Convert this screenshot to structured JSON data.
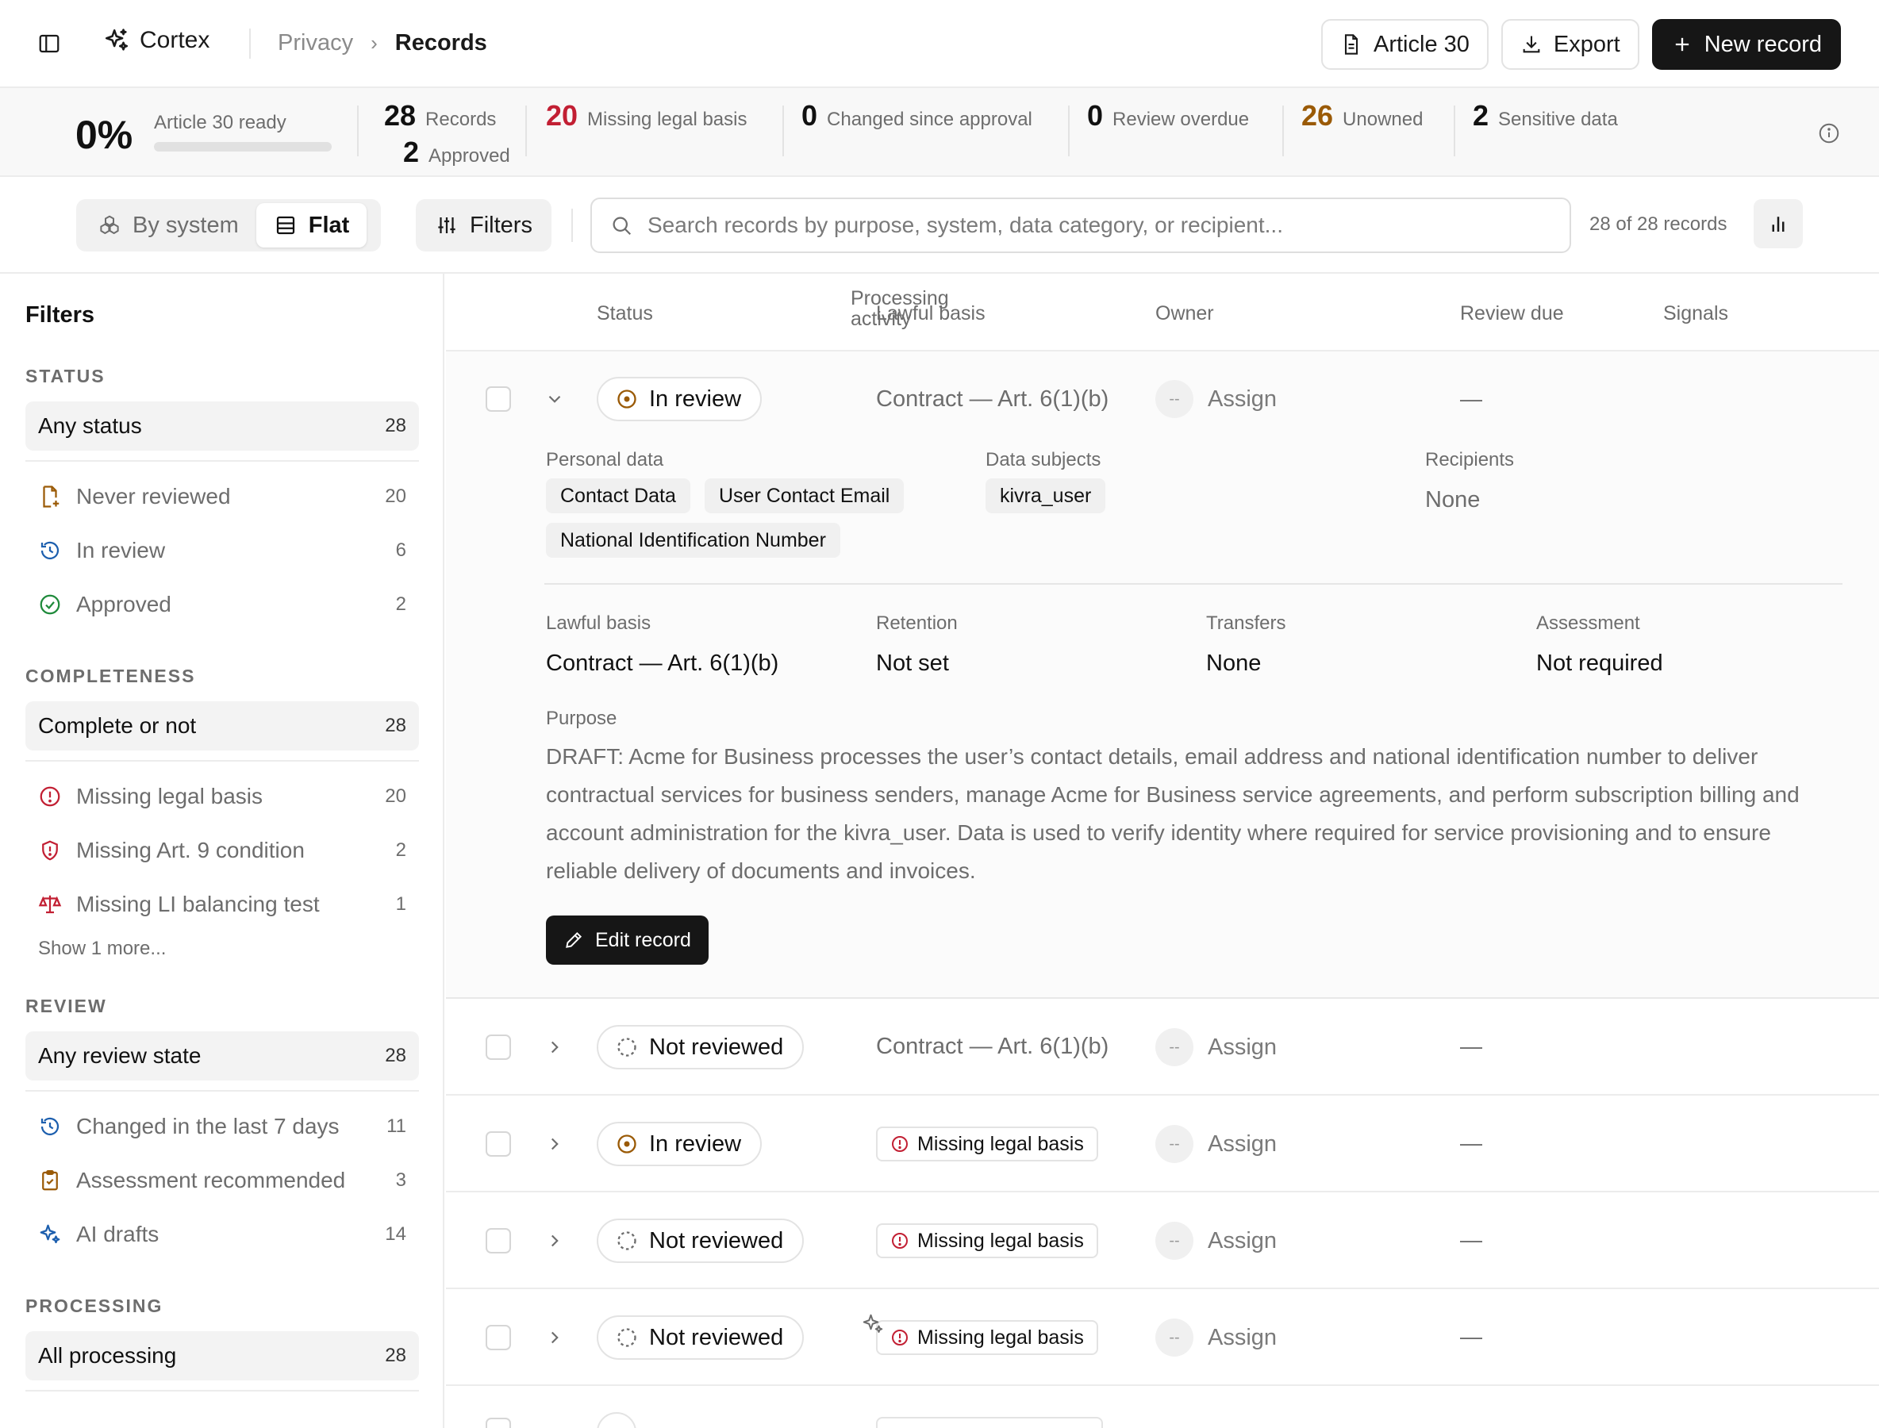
{
  "header": {
    "brand": "Cortex",
    "breadcrumb": [
      "Privacy",
      "Records"
    ],
    "actions": {
      "article30": "Article 30",
      "export": "Export",
      "new_record": "New record"
    }
  },
  "metrics": {
    "ready_pct": "0%",
    "ready_label": "Article 30 ready",
    "ready_progress": 0,
    "records": {
      "num": "28",
      "label": "Records"
    },
    "approved": {
      "num": "2",
      "label": "Approved"
    },
    "missing": {
      "num": "20",
      "label": "Missing legal basis"
    },
    "changed": {
      "num": "0",
      "label": "Changed since approval"
    },
    "overdue": {
      "num": "0",
      "label": "Review overdue"
    },
    "unowned": {
      "num": "26",
      "label": "Unowned"
    },
    "sensitive": {
      "num": "2",
      "label": "Sensitive data"
    }
  },
  "toolbar": {
    "by_system": "By system",
    "flat": "Flat",
    "filters": "Filters",
    "search_placeholder": "Search records by purpose, system, data category, or recipient...",
    "count": "28 of 28 records"
  },
  "sidebar": {
    "title": "Filters",
    "status": {
      "heading": "STATUS",
      "all": {
        "label": "Any status",
        "count": "28"
      },
      "items": [
        {
          "label": "Never reviewed",
          "count": "20"
        },
        {
          "label": "In review",
          "count": "6"
        },
        {
          "label": "Approved",
          "count": "2"
        }
      ]
    },
    "completeness": {
      "heading": "COMPLETENESS",
      "all": {
        "label": "Complete or not",
        "count": "28"
      },
      "items": [
        {
          "label": "Missing legal basis",
          "count": "20"
        },
        {
          "label": "Missing Art. 9 condition",
          "count": "2"
        },
        {
          "label": "Missing LI balancing test",
          "count": "1"
        }
      ],
      "more": "Show 1 more..."
    },
    "review": {
      "heading": "REVIEW",
      "all": {
        "label": "Any review state",
        "count": "28"
      },
      "items": [
        {
          "label": "Changed in the last 7 days",
          "count": "11"
        },
        {
          "label": "Assessment recommended",
          "count": "3"
        },
        {
          "label": "AI drafts",
          "count": "14"
        }
      ]
    },
    "processing": {
      "heading": "PROCESSING",
      "all": {
        "label": "All processing",
        "count": "28"
      }
    }
  },
  "table": {
    "columns": {
      "status": "Status",
      "activity": "Processing activity",
      "basis": "Lawful basis",
      "owner": "Owner",
      "review": "Review due",
      "signals": "Signals"
    },
    "rows": [
      {
        "status": "In review",
        "basis": "Contract — Art. 6(1)(b)",
        "owner_initials": "--",
        "owner": "Assign",
        "review": "—"
      },
      {
        "status": "Not reviewed",
        "basis": "Contract — Art. 6(1)(b)",
        "owner_initials": "--",
        "owner": "Assign",
        "review": "—"
      },
      {
        "status": "In review",
        "basis": "Missing legal basis",
        "owner_initials": "--",
        "owner": "Assign",
        "review": "—"
      },
      {
        "status": "Not reviewed",
        "basis": "Missing legal basis",
        "owner_initials": "--",
        "owner": "Assign",
        "review": "—"
      },
      {
        "status": "Not reviewed",
        "basis": "Missing legal basis",
        "owner_initials": "--",
        "owner": "Assign",
        "review": "—"
      }
    ]
  },
  "detail": {
    "personal_data_label": "Personal data",
    "personal_data": [
      "Contact Data",
      "User Contact Email",
      "National Identification Number"
    ],
    "data_subjects_label": "Data subjects",
    "data_subjects": [
      "kivra_user"
    ],
    "recipients_label": "Recipients",
    "recipients": "None",
    "lawful_basis_label": "Lawful basis",
    "lawful_basis": "Contract — Art. 6(1)(b)",
    "retention_label": "Retention",
    "retention": "Not set",
    "transfers_label": "Transfers",
    "transfers": "None",
    "assessment_label": "Assessment",
    "assessment": "Not required",
    "purpose_label": "Purpose",
    "purpose": "DRAFT: Acme for Business processes the user’s contact details, email address and national identification number to deliver contractual services for business senders, manage Acme for Business service agreements, and perform subscription billing and account administration for the kivra_user. Data is used to verify identity where required for service provisioning and to ensure reliable delivery of documents and invoices.",
    "edit_button": "Edit record"
  },
  "colors": {
    "red": "#c21f33",
    "amber": "#9a5a06",
    "blue": "#1d5fae",
    "green": "#1f8a3b"
  }
}
